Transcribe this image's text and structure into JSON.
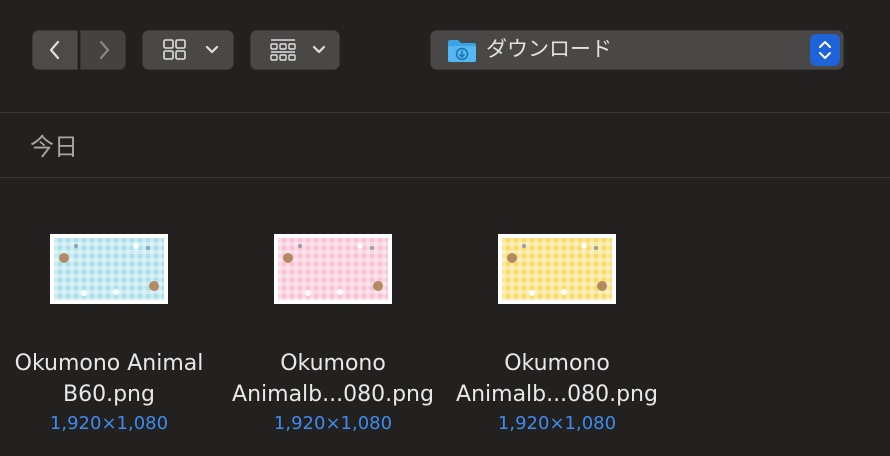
{
  "toolbar": {
    "back_icon": "chevron-left-icon",
    "forward_icon": "chevron-right-icon",
    "view_icon": "icon-grid-icon",
    "group_icon": "group-by-icon",
    "path": {
      "label": "ダウンロード",
      "folder_icon": "downloads-folder-icon",
      "stepper_icon": "up-down-stepper-icon"
    }
  },
  "section": {
    "title": "今日"
  },
  "files": [
    {
      "name_line1": "Okumono Animal",
      "name_line2": "B60.png",
      "dimensions": "1,920×1,080",
      "thumb_color": "#aee0ea"
    },
    {
      "name_line1": "Okumono",
      "name_line2": "Animalb...080.png",
      "dimensions": "1,920×1,080",
      "thumb_color": "#f8c2d4"
    },
    {
      "name_line1": "Okumono",
      "name_line2": "Animalb...080.png",
      "dimensions": "1,920×1,080",
      "thumb_color": "#f8dc6a"
    }
  ],
  "colors": {
    "accent": "#1e63d8",
    "dimension_text": "#3c8cf0",
    "background": "#232120"
  }
}
